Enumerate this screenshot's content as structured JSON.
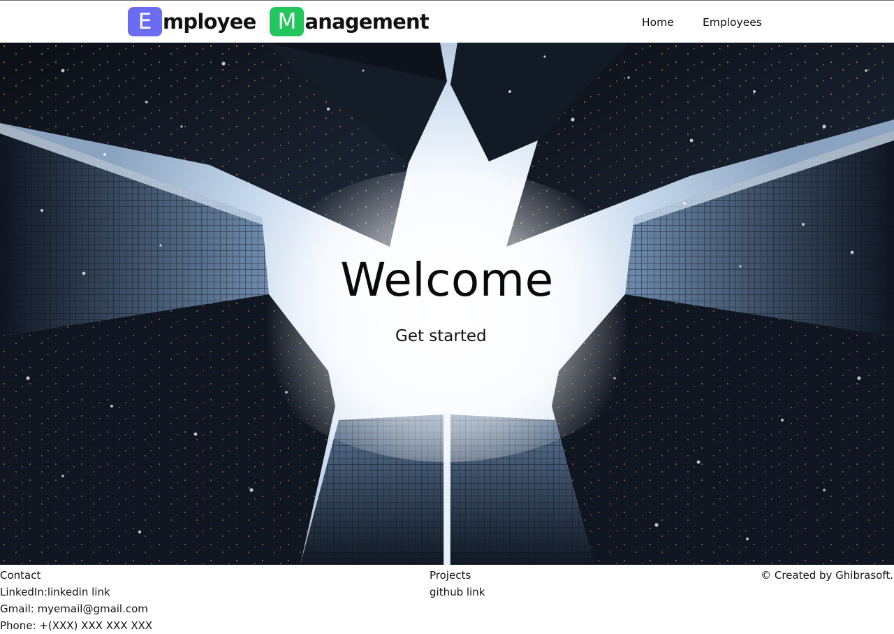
{
  "navbar": {
    "brand": {
      "word1_initial": "E",
      "word1_rest": "mployee",
      "word2_initial": "M",
      "word2_rest": "anagement",
      "badge1_color": "#6c6cf2",
      "badge2_color": "#22c55e"
    },
    "links": [
      {
        "label": "Home"
      },
      {
        "label": "Employees"
      }
    ]
  },
  "hero": {
    "title": "Welcome",
    "cta_label": "Get started",
    "background_image": "skyscrapers-looking-up"
  },
  "footer": {
    "contact": {
      "heading": "Contact",
      "linkedin_prefix": "LinkedIn:",
      "linkedin_link": "linkedin link",
      "gmail": "Gmail: myemail@gmail.com",
      "phone": "Phone: +(XXX) XXX XXX XXX"
    },
    "projects": {
      "heading": "Projects",
      "github_link": "github link"
    },
    "copyright": "© Created by Ghibrasoft."
  }
}
